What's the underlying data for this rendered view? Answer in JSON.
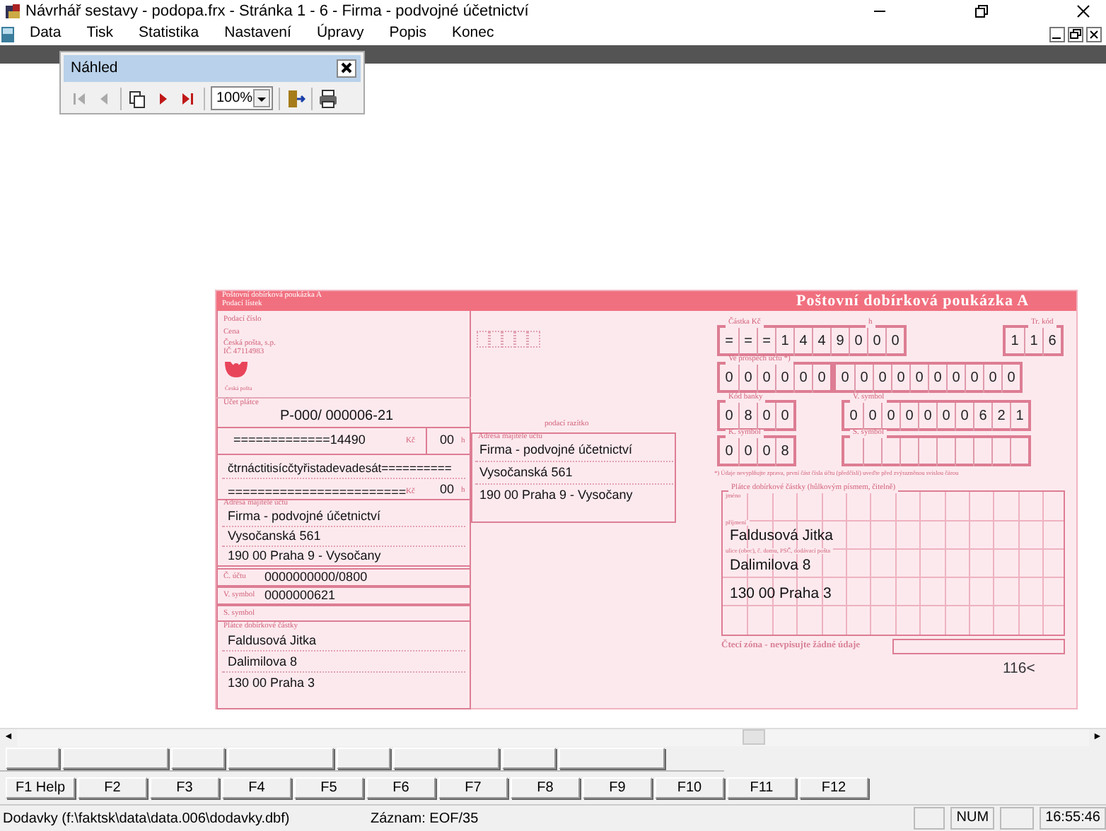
{
  "window": {
    "title": "Návrhář sestavy - podopa.frx - Stránka 1 -  6 - Firma - podvojné účetnictví"
  },
  "menu": [
    "Data",
    "Tisk",
    "Statistika",
    "Nastavení",
    "Úpravy",
    "Popis",
    "Konec"
  ],
  "preview_toolbar": {
    "title": "Náhled",
    "zoom": "100%",
    "buttons": [
      {
        "kind": "first",
        "disabled": true
      },
      {
        "kind": "prev",
        "disabled": true
      },
      {
        "kind": "pages"
      },
      {
        "kind": "next",
        "disabled": false
      },
      {
        "kind": "last",
        "disabled": false
      },
      {
        "kind": "zoom"
      },
      {
        "kind": "exit"
      },
      {
        "kind": "print"
      }
    ]
  },
  "stub": {
    "header": [
      "Poštovní dobírková poukázka A",
      "Podací lístek"
    ],
    "labels": [
      "Podací číslo",
      "Cena",
      "Česká pošta, s.p.",
      "IČ 47114983"
    ],
    "logo_caption": "Česká pošta",
    "account_label": "Účet plátce",
    "account": "P-000/ 000006-21",
    "amount": "=============14490",
    "currency": "Kč",
    "cents": "00",
    "cents_unit": "h",
    "amount_words": "čtrnáctitisícčtyřistadevadesát==========",
    "amount2": "========================",
    "currency2": "Kč",
    "cents2": "00",
    "cents_unit2": "h",
    "owner_label": "Adresa majitele účtu",
    "owner": [
      "Firma - podvojné účetnictví",
      "Vysočanská 561",
      "190 00  Praha 9 - Vysočany"
    ],
    "account_no_label": "Č. účtu",
    "account_no": "0000000000/0800",
    "vs_label": "V. symbol",
    "vs": "0000000621",
    "ss_label": "S. symbol",
    "payer_label": "Plátce dobírkové částky",
    "payer": [
      "Faldusová Jitka",
      "Dalimilova 8",
      "130 00  Praha 3"
    ]
  },
  "middle": {
    "stamp_label": "podací razítko",
    "owner_label": "Adresa majitele účtu",
    "owner": [
      "Firma - podvojné účetnictví",
      "Vysočanská 561",
      "190 00  Praha 9 - Vysočany"
    ]
  },
  "coupon": {
    "title": "Poštovní dobírková poukázka A",
    "amount_label": "Částka Kč",
    "amount": [
      "=",
      "=",
      "=",
      "1",
      "4",
      "4",
      "9",
      "0"
    ],
    "cents_label": "h",
    "cents": [
      "0",
      "0"
    ],
    "code_label": "Tr. kód",
    "code": [
      "1",
      "1",
      "6"
    ],
    "account_label": "Ve prospěch účtu *)",
    "account_prefix": [
      "0",
      "0",
      "0",
      "0",
      "0",
      "0"
    ],
    "account": [
      "0",
      "0",
      "0",
      "0",
      "0",
      "0",
      "0",
      "0",
      "0",
      "0"
    ],
    "bank_label": "Kód banky",
    "bank": [
      "0",
      "8",
      "0",
      "0"
    ],
    "vs_label": "V. symbol",
    "vs": [
      "0",
      "0",
      "0",
      "0",
      "0",
      "0",
      "0",
      "6",
      "2",
      "1"
    ],
    "ks_label": "K. symbol",
    "ks": [
      "0",
      "0",
      "0",
      "8"
    ],
    "ss_label": "S. symbol",
    "note": "*) Údaje nevyplňujte zprava, první část čísla účtu (předčíslí) uveďte před zvýrazněnou svislou čárou",
    "payer_label": "Plátce dobírkové částky (hůlkovým písmem, čitelně)",
    "payer_fields": [
      "jméno",
      "příjmení",
      "ulice (obec), č. domu, PSČ, dodávací pošta"
    ],
    "payer": [
      "Faldusová Jitka",
      "Dalimilova 8",
      "130 00  Praha 3"
    ],
    "reading_zone": "Čtecí zóna - nevpisujte žádné údaje",
    "code_line": "116<"
  },
  "scroll_arrows": [
    "◄",
    "►"
  ],
  "function_keys": [
    "F1 Help",
    "F2",
    "F3",
    "F4",
    "F5",
    "F6",
    "F7",
    "F8",
    "F9",
    "F10",
    "F11",
    "F12"
  ],
  "status_bar": {
    "file": "Dodavky (f:\\faktsk\\data\\data.006\\dodavky.dbf)",
    "record": "Záznam: EOF/35",
    "num": "NUM",
    "time": "16:55:46"
  }
}
